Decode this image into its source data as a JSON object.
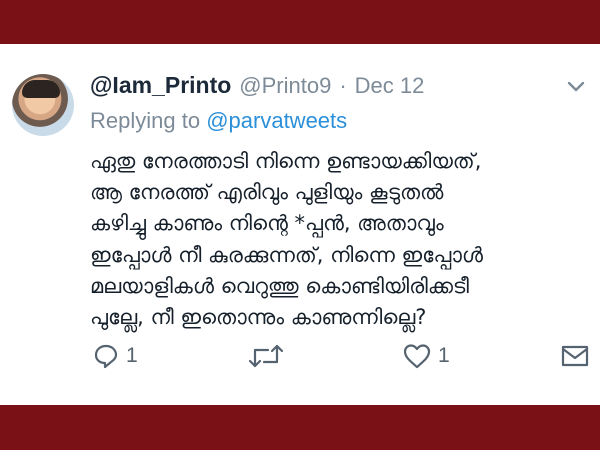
{
  "tweet": {
    "display_name": "@Iam_Printo",
    "handle": "@Printo9",
    "separator": "·",
    "date": "Dec 12",
    "replying_prefix": "Replying to",
    "replying_to": "@parvatweets",
    "lines": [
      "ഏതു നേരത്താടി നിന്നെ ഉണ്ടായക്കിയത്,",
      "ആ നേരത്ത് എരിവും പുളിയും കൂടുതൽ",
      "കഴിച്ചു കാണും നിന്റെ *പ്പൻ, അതാവും",
      "ഇപ്പോൾ നീ കുരക്കുന്നത്, നിന്നെ ഇപ്പോൾ",
      "മലയാളികൾ വെറുത്തു കൊണ്ടിയിരിക്കടീ",
      "പുല്ലേ, നീ ഇതൊന്നും കാണുന്നില്ലെ?"
    ],
    "reply_count": "1",
    "like_count": "1"
  },
  "icons": {
    "reply": "reply-icon",
    "retweet": "retweet-icon",
    "like": "heart-icon",
    "message": "envelope-icon",
    "more": "chevron-down-icon"
  },
  "colors": {
    "frame": "#7a1116",
    "link": "#2b90d9",
    "muted": "#7d8b98",
    "text": "#16202b"
  }
}
